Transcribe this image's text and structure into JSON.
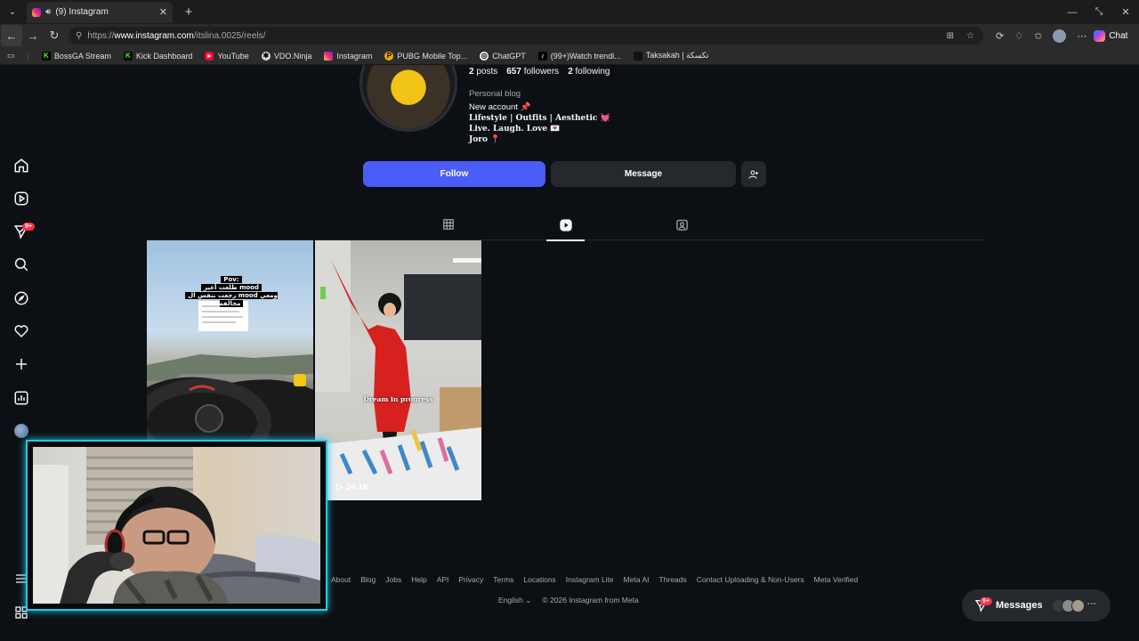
{
  "browser": {
    "tab_title": "(9) Instagram",
    "url_prefix": "https://",
    "url_host": "www.instagram.com",
    "url_path": "/itslina.0025/reels/",
    "copilot_label": "Chat"
  },
  "bookmarks": [
    {
      "label": "BossGA Stream",
      "color": "#53fc18"
    },
    {
      "label": "Kick Dashboard",
      "color": "#53fc18"
    },
    {
      "label": "YouTube",
      "color": "#ff0033"
    },
    {
      "label": "VDO.Ninja",
      "color": "#ffffff"
    },
    {
      "label": "Instagram",
      "color": "#e1306c"
    },
    {
      "label": "PUBG Mobile Top...",
      "color": "#f2a900"
    },
    {
      "label": "ChatGPT",
      "color": "#ffffff"
    },
    {
      "label": "(99+)Watch trendi...",
      "color": "#ffffff"
    },
    {
      "label": "Taksakah | تكسكة",
      "color": "#000000"
    }
  ],
  "sidebar": {
    "notifications_badge": "9+"
  },
  "profile": {
    "posts_count": "2",
    "posts_label": "posts",
    "followers_count": "657",
    "followers_label": "followers",
    "following_count": "2",
    "following_label": "following",
    "category": "Personal blog",
    "bio_line1": "New account 📌",
    "bio_line2": "𝐋𝐢𝐟𝐞𝐬𝐭𝐲𝐥𝐞 | 𝐎𝐮𝐭𝐟𝐢𝐭𝐬 | 𝐀𝐞𝐬𝐭𝐡𝐞𝐭𝐢𝐜 💓",
    "bio_line3": "𝐋𝐢𝐯𝐞. 𝐋𝐚𝐮𝐠𝐡. 𝐋𝐨𝐯𝐞 💌",
    "bio_line4": "𝐉𝐨𝐫𝐨 📍",
    "follow_label": "Follow",
    "message_label": "Message"
  },
  "reels": {
    "reel1_overlay_title": "Pov:",
    "reel1_overlay_line1": "طلعت أغير mood",
    "reel1_overlay_line2": "رجعت بنفس ال mood ومعي مخالفة",
    "reel2_caption": "Dream in progress",
    "reel2_views": "24.1K"
  },
  "footer": {
    "links": [
      "About",
      "Blog",
      "Jobs",
      "Help",
      "API",
      "Privacy",
      "Terms",
      "Locations",
      "Instagram Lite",
      "Meta AI",
      "Threads",
      "Contact Uploading & Non-Users",
      "Meta Verified"
    ],
    "language": "English",
    "copyright": "© 2026 Instagram from Meta"
  },
  "messages": {
    "label": "Messages",
    "badge": "9+"
  },
  "colors": {
    "follow_button": "#4a5df9",
    "badge": "#ff3040",
    "webcam_border": "#21c8e8"
  }
}
